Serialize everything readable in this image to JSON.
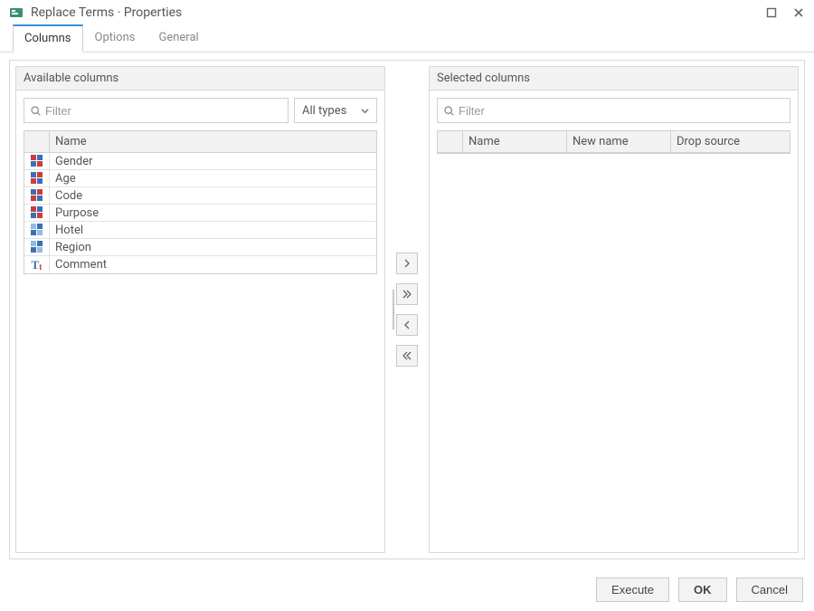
{
  "window": {
    "title": "Replace Terms · Properties"
  },
  "tabs": [
    {
      "id": "columns",
      "label": "Columns",
      "active": true
    },
    {
      "id": "options",
      "label": "Options",
      "active": false
    },
    {
      "id": "general",
      "label": "General",
      "active": false
    }
  ],
  "available": {
    "title": "Available columns",
    "filter_placeholder": "Filter",
    "type_filter": "All types",
    "header_name": "Name",
    "rows": [
      {
        "name": "Gender",
        "icon": "cat-a"
      },
      {
        "name": "Age",
        "icon": "cat-b"
      },
      {
        "name": "Code",
        "icon": "cat-b"
      },
      {
        "name": "Purpose",
        "icon": "cat-a"
      },
      {
        "name": "Hotel",
        "icon": "cat-c"
      },
      {
        "name": "Region",
        "icon": "cat-c"
      },
      {
        "name": "Comment",
        "icon": "text"
      }
    ]
  },
  "selected": {
    "title": "Selected columns",
    "filter_placeholder": "Filter",
    "header_name": "Name",
    "header_new_name": "New name",
    "header_drop_source": "Drop source",
    "rows": []
  },
  "footer": {
    "execute": "Execute",
    "ok": "OK",
    "cancel": "Cancel"
  }
}
